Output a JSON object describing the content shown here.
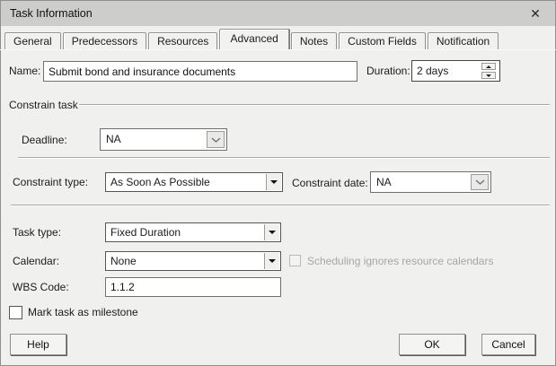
{
  "window": {
    "title": "Task Information"
  },
  "icons": {
    "close": "✕"
  },
  "tabs": [
    {
      "label": "General"
    },
    {
      "label": "Predecessors"
    },
    {
      "label": "Resources"
    },
    {
      "label": "Advanced"
    },
    {
      "label": "Notes"
    },
    {
      "label": "Custom Fields"
    },
    {
      "label": "Notification"
    }
  ],
  "form": {
    "name": {
      "label": "Name:",
      "value": "Submit bond and insurance documents"
    },
    "duration": {
      "label": "Duration:",
      "value": "2 days"
    },
    "constrain_group": {
      "label": "Constrain task"
    },
    "deadline": {
      "label": "Deadline:",
      "value": "NA"
    },
    "constraint_type": {
      "label": "Constraint type:",
      "value": "As Soon As Possible"
    },
    "constraint_date": {
      "label": "Constraint date:",
      "value": "NA"
    },
    "task_type": {
      "label": "Task type:",
      "value": "Fixed Duration"
    },
    "calendar": {
      "label": "Calendar:",
      "value": "None"
    },
    "scheduling_ignores": {
      "label": "Scheduling ignores resource calendars",
      "checked": false,
      "disabled": true
    },
    "wbs_code": {
      "label": "WBS Code:",
      "value": "1.1.2"
    },
    "milestone": {
      "label": "Mark task as milestone",
      "checked": false
    }
  },
  "buttons": {
    "help": "Help",
    "ok": "OK",
    "cancel": "Cancel"
  },
  "colors": {
    "dialog_bg": "#f0f0ef",
    "titlebar_bg": "#cdcdcb",
    "field_bg": "#ffffff",
    "disabled_text": "#a6a6a4"
  }
}
